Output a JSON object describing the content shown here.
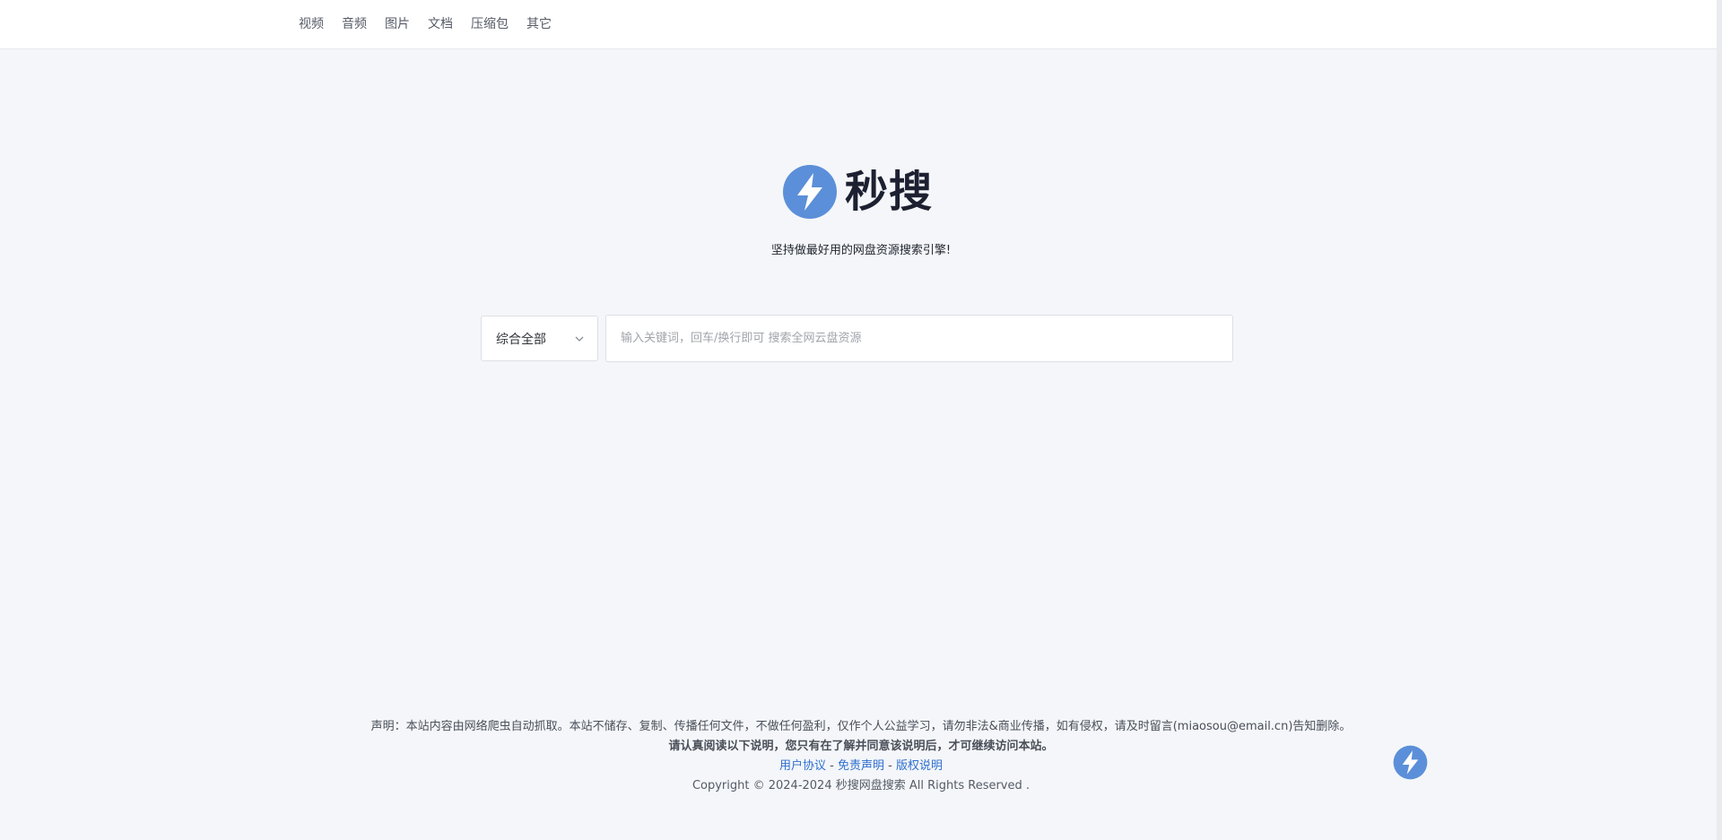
{
  "nav": {
    "items": [
      {
        "label": "视频"
      },
      {
        "label": "音频"
      },
      {
        "label": "图片"
      },
      {
        "label": "文档"
      },
      {
        "label": "压缩包"
      },
      {
        "label": "其它"
      }
    ]
  },
  "brand": {
    "name": "秒搜",
    "icon": "lightning-bolt-icon",
    "icon_color": "#5b8fd9"
  },
  "slogan": "坚持做最好用的网盘资源搜索引擎!",
  "search": {
    "category_selected": "综合全部",
    "placeholder": "输入关键词，回车/换行即可 搜索全网云盘资源",
    "value": ""
  },
  "footer": {
    "statement": "声明：本站内容由网络爬虫自动抓取。本站不储存、复制、传播任何文件，不做任何盈利，仅作个人公益学习，请勿非法&商业传播，如有侵权，请及时留言(miaosou@email.cn)告知删除。",
    "notice": "请认真阅读以下说明，您只有在了解并同意该说明后，才可继续访问本站。",
    "links": [
      {
        "label": "用户协议"
      },
      {
        "label": "免责声明"
      },
      {
        "label": "版权说明"
      }
    ],
    "link_separator": " - ",
    "copyright": "Copyright © 2024-2024 秒搜网盘搜索 All Rights Reserved ."
  },
  "colors": {
    "link": "#2f6fcf",
    "background": "#f4f6f9",
    "brand_text": "#1c2030"
  }
}
